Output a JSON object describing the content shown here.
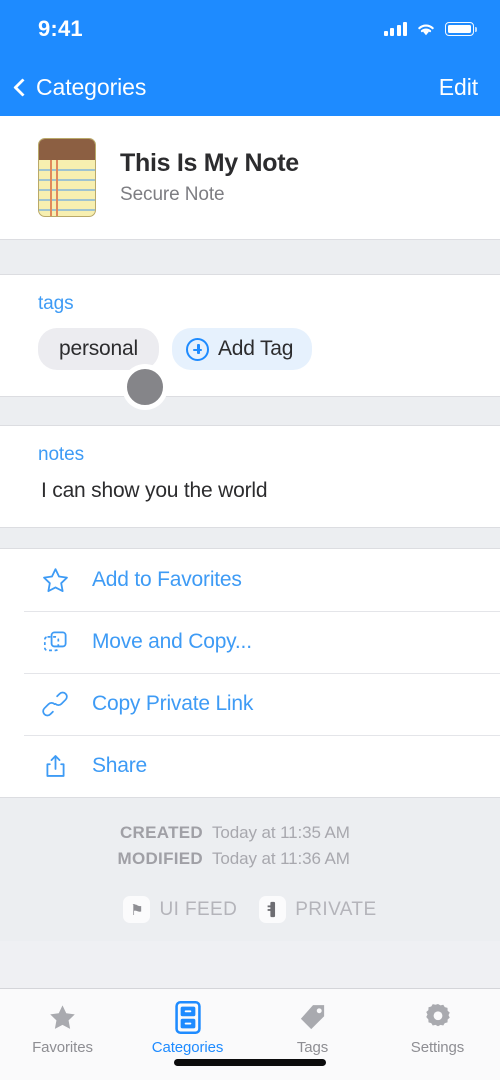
{
  "status_bar": {
    "time": "9:41",
    "signal_icon": "cellular-signal-icon",
    "wifi_icon": "wifi-icon",
    "battery_icon": "battery-icon"
  },
  "nav_bar": {
    "back_label": "Categories",
    "back_icon": "chevron-left-icon",
    "edit_label": "Edit",
    "background_color": "#1e8bff"
  },
  "note_header": {
    "icon": "notepad-icon",
    "title": "This Is My Note",
    "subtitle": "Secure Note"
  },
  "avatar": {
    "icon": "user-avatar",
    "color": "#858589"
  },
  "tags_section": {
    "label": "tags",
    "tags": [
      "personal"
    ],
    "add_tag_label": "Add Tag",
    "add_tag_icon": "plus-circle-icon"
  },
  "notes_section": {
    "label": "notes",
    "body": "I can show you the world"
  },
  "actions": [
    {
      "label": "Add to Favorites",
      "icon": "star-icon"
    },
    {
      "label": "Move and Copy...",
      "icon": "move-copy-icon"
    },
    {
      "label": "Copy Private Link",
      "icon": "link-icon"
    },
    {
      "label": "Share",
      "icon": "share-icon"
    }
  ],
  "metadata": {
    "created_label": "CREATED",
    "created_value": "Today at 11:35 AM",
    "modified_label": "MODIFIED",
    "modified_value": "Today at 11:36 AM",
    "badges": [
      {
        "label": "UI FEED",
        "icon": "flag-icon",
        "glyph": "⚑"
      },
      {
        "label": "PRIVATE",
        "icon": "key-icon",
        "glyph": "✂"
      }
    ]
  },
  "tab_bar": {
    "active_color": "#1e8bff",
    "inactive_color": "#8e8e93",
    "tabs": [
      {
        "label": "Favorites",
        "icon": "star-icon",
        "active": false
      },
      {
        "label": "Categories",
        "icon": "filing-cabinet-icon",
        "active": true
      },
      {
        "label": "Tags",
        "icon": "tag-icon",
        "active": false
      },
      {
        "label": "Settings",
        "icon": "gear-icon",
        "active": false
      }
    ]
  }
}
